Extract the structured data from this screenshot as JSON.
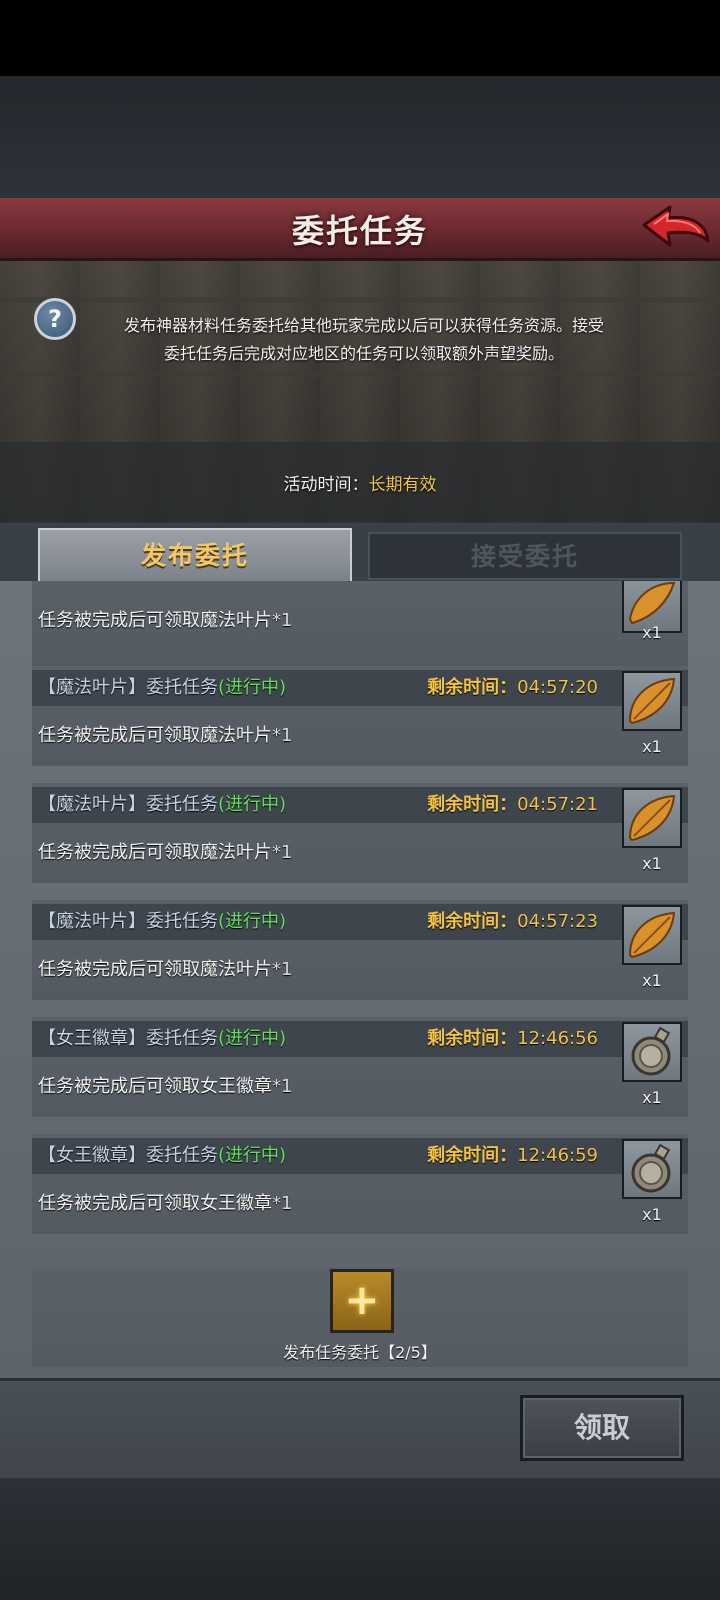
{
  "header": {
    "title": "委托任务"
  },
  "info": {
    "text_line1": "发布神器材料任务委托给其他玩家完成以后可以获得任务资源。接受",
    "text_line2": "委托任务后完成对应地区的任务可以领取额外声望奖励。",
    "icon_glyph": "?"
  },
  "activity": {
    "label": "活动时间：",
    "value": "长期有效"
  },
  "tabs": [
    {
      "label": "发布委托",
      "active": true
    },
    {
      "label": "接受委托",
      "active": false
    }
  ],
  "tasks": [
    {
      "title": "",
      "status": "",
      "time_label": "",
      "time": "",
      "desc": "任务被完成后可领取魔法叶片",
      "qty": "*1",
      "item": "magic-leaf",
      "count": "x1"
    },
    {
      "title": "【魔法叶片】委托任务",
      "status": "(进行中)",
      "time_label": "剩余时间：",
      "time": "04:57:20",
      "desc": "任务被完成后可领取魔法叶片",
      "qty": "*1",
      "item": "magic-leaf",
      "count": "x1"
    },
    {
      "title": "【魔法叶片】委托任务",
      "status": "(进行中)",
      "time_label": "剩余时间：",
      "time": "04:57:21",
      "desc": "任务被完成后可领取魔法叶片",
      "qty": "*1",
      "item": "magic-leaf",
      "count": "x1"
    },
    {
      "title": "【魔法叶片】委托任务",
      "status": "(进行中)",
      "time_label": "剩余时间：",
      "time": "04:57:23",
      "desc": "任务被完成后可领取魔法叶片",
      "qty": "*1",
      "item": "magic-leaf",
      "count": "x1"
    },
    {
      "title": "【女王徽章】委托任务",
      "status": "(进行中)",
      "time_label": "剩余时间：",
      "time": "12:46:56",
      "desc": "任务被完成后可领取女王徽章",
      "qty": "*1",
      "item": "queen-badge",
      "count": "x1"
    },
    {
      "title": "【女王徽章】委托任务",
      "status": "(进行中)",
      "time_label": "剩余时间：",
      "time": "12:46:59",
      "desc": "任务被完成后可领取女王徽章",
      "qty": "*1",
      "item": "queen-badge",
      "count": "x1"
    }
  ],
  "add": {
    "glyph": "+",
    "label": "发布任务委托【2/5】"
  },
  "footer": {
    "claim_label": "领取"
  },
  "icons": {
    "back": "back-arrow-icon",
    "info": "question-icon",
    "add": "plus-icon",
    "leaf": "magic-leaf-icon",
    "badge": "queen-badge-icon"
  },
  "colors": {
    "header": "#7a3238",
    "status": "#62e05c",
    "time": "#f1c244",
    "tab_active": "#f4c767",
    "activity_value": "#f0c44a"
  }
}
